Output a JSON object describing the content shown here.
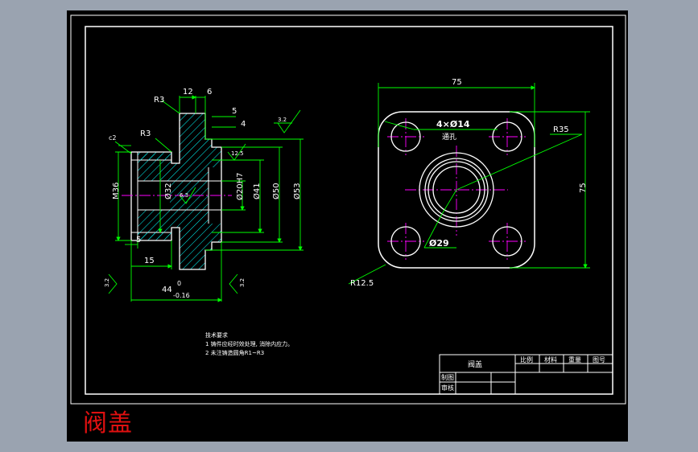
{
  "title_overlay": "阀盖",
  "colors": {
    "background": "#9aa3b0",
    "sheet": "#000000",
    "outline": "#ffffff",
    "dimension": "#00ff00",
    "centerline": "#ff00ff",
    "hatch": "#00ffff",
    "overlay_title": "#e01010"
  },
  "side_view": {
    "dims": {
      "w12": "12",
      "w6": "6",
      "w5": "5",
      "w4": "4",
      "r3_top": "R3",
      "r3_mid": "R3",
      "c2": "c2",
      "m36": "M36",
      "d32": "Ø32",
      "d20h7": "Ø20H7",
      "d41": "Ø41",
      "d50": "Ø50",
      "d53": "Ø53",
      "rough_12_5": "12.5",
      "rough_6_3": "6.3",
      "rough_3_2_top": "3.2",
      "rough_3_2_left": "3.2",
      "rough_3_2_right": "3.2",
      "l5": "5",
      "l15": "15",
      "l44": "44",
      "tol_upper": "0",
      "tol_lower": "-0.16"
    }
  },
  "front_view": {
    "dims": {
      "w75": "75",
      "h75": "75",
      "holes": "4×Ø14",
      "thru": "通孔",
      "r35": "R35",
      "d29": "Ø29",
      "r12_5": "R12.5"
    }
  },
  "notes": {
    "heading": "技术要求",
    "line1": "1 铸件应经时效处理, 消除内应力。",
    "line2": "2 未注铸造圆角R1~R3"
  },
  "title_block": {
    "part_name": "阀盖",
    "ratio": "比例",
    "material": "材料",
    "weight": "重量",
    "drawing_no": "图号",
    "drawn": "制图",
    "checked": "审核"
  }
}
